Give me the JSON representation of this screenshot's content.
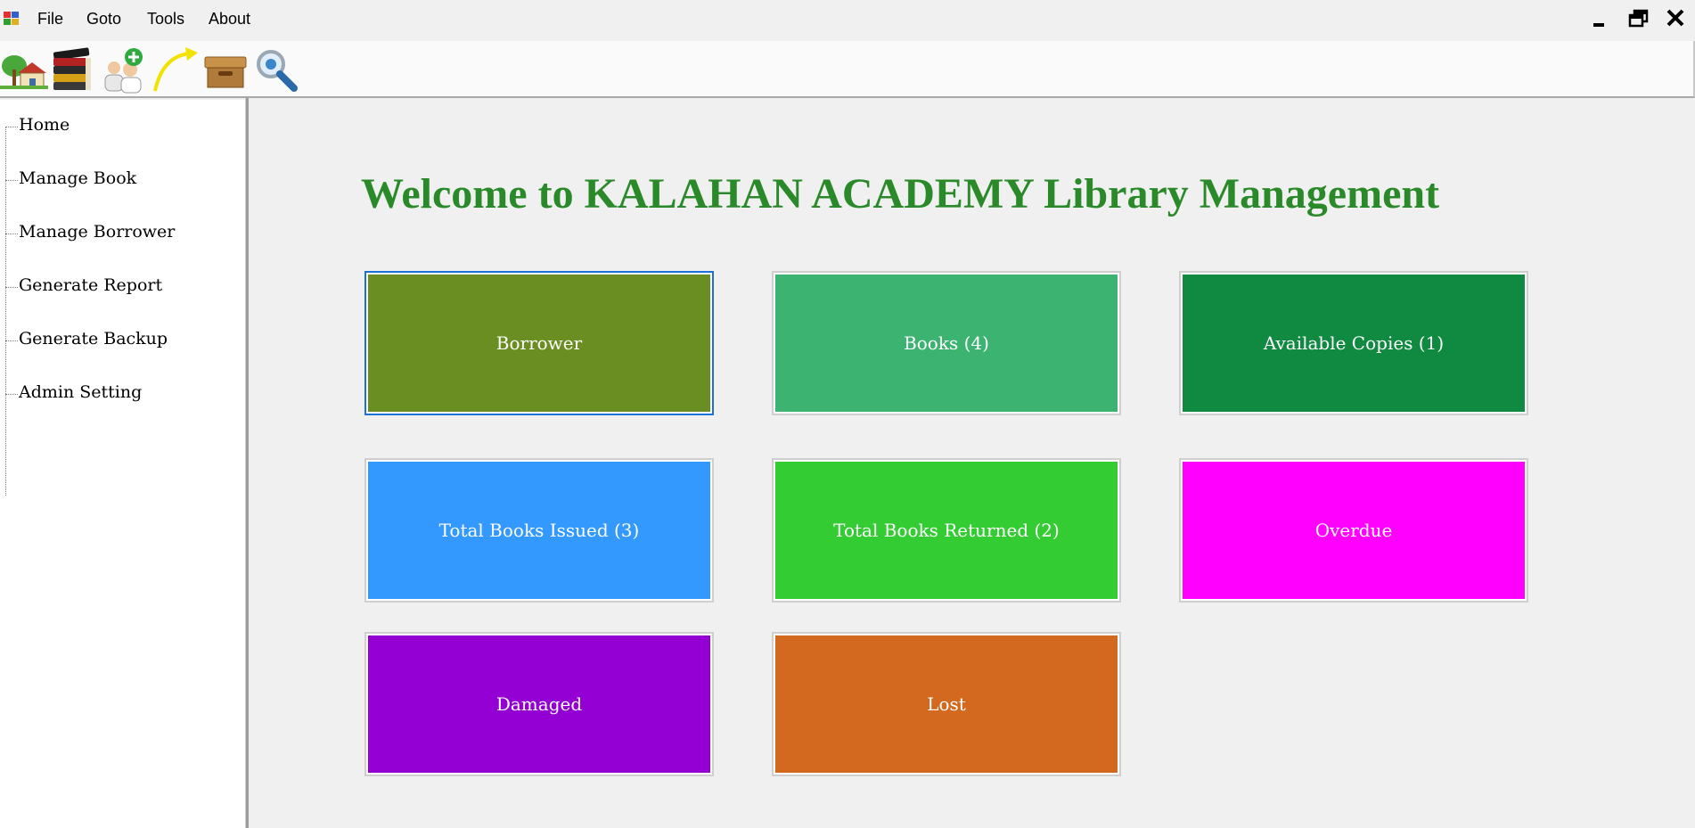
{
  "menu": {
    "items": [
      "File",
      "Goto",
      "Tools",
      "About"
    ]
  },
  "window_controls": {
    "minimize": "🗕",
    "restore": "🗗",
    "close": "✕"
  },
  "toolbar": {
    "icons": [
      "home-icon",
      "books-icon",
      "add-user-icon",
      "arrow-icon",
      "box-icon",
      "search-icon"
    ]
  },
  "sidebar": {
    "items": [
      {
        "label": "Home"
      },
      {
        "label": "Manage Book"
      },
      {
        "label": "Manage Borrower"
      },
      {
        "label": "Generate Report"
      },
      {
        "label": "Generate Backup"
      },
      {
        "label": "Admin Setting"
      }
    ]
  },
  "main": {
    "welcome": "Welcome to KALAHAN ACADEMY Library Management",
    "tiles": [
      {
        "label": "Borrower",
        "color": "#6b8e23"
      },
      {
        "label": "Books (4)",
        "color": "#3cb371"
      },
      {
        "label": "Available Copies (1)",
        "color": "#108a40"
      },
      {
        "label": "Total Books Issued (3)",
        "color": "#3399ff"
      },
      {
        "label": "Total Books Returned (2)",
        "color": "#33cc33"
      },
      {
        "label": "Overdue",
        "color": "#ff00ff"
      },
      {
        "label": "Damaged",
        "color": "#9400d3"
      },
      {
        "label": "Lost",
        "color": "#d2691e"
      }
    ]
  }
}
